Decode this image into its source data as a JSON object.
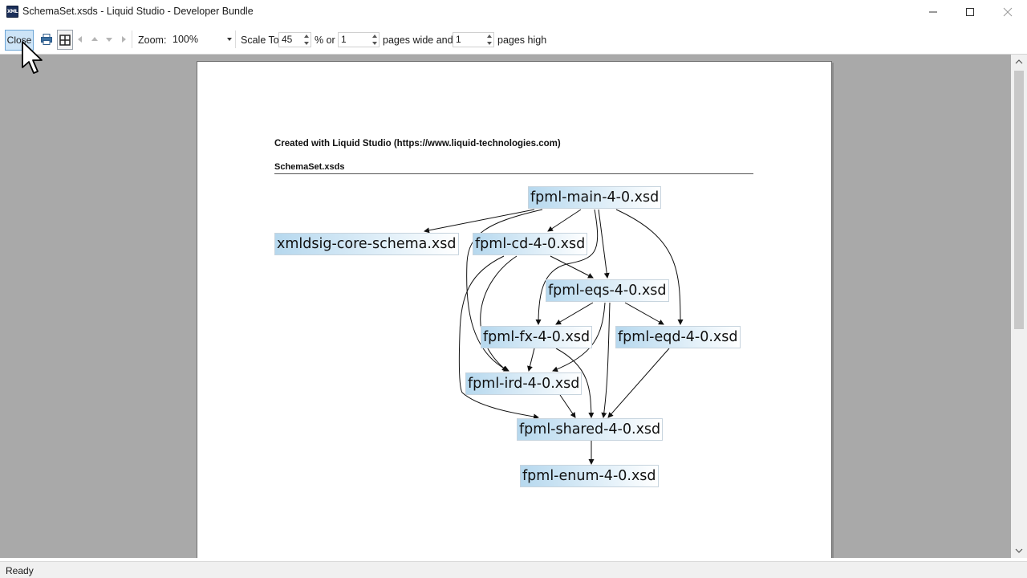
{
  "window": {
    "title": "SchemaSet.xsds - Liquid Studio - Developer Bundle",
    "app_icon_text": "XML"
  },
  "toolbar": {
    "close_label": "Close",
    "zoom_label": "Zoom:",
    "zoom_value": "100%",
    "scale_label": "Scale To:",
    "scale_value": "45",
    "percent_or": "% or",
    "pages_wide_value": "1",
    "pages_wide_label": "pages wide and",
    "pages_high_value": "1",
    "pages_high_label": "pages high"
  },
  "page": {
    "credit": "Created with Liquid Studio (https://www.liquid-technologies.com)",
    "doc_title": "SchemaSet.xsds"
  },
  "diagram": {
    "nodes": {
      "main": "fpml-main-4-0.xsd",
      "xmldsig": "xmldsig-core-schema.xsd",
      "cd": "fpml-cd-4-0.xsd",
      "eqs": "fpml-eqs-4-0.xsd",
      "fx": "fpml-fx-4-0.xsd",
      "eqd": "fpml-eqd-4-0.xsd",
      "ird": "fpml-ird-4-0.xsd",
      "shared": "fpml-shared-4-0.xsd",
      "enum": "fpml-enum-4-0.xsd"
    }
  },
  "status": {
    "text": "Ready"
  },
  "colors": {
    "preview_background": "#a9a9a9",
    "close_button_highlight": "#cde4f7",
    "node_gradient_start": "#b6d8ee"
  }
}
